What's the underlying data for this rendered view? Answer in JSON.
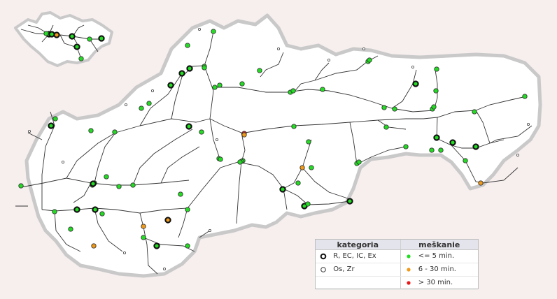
{
  "legend": {
    "header_category": "kategoria",
    "header_delay": "meškanie",
    "categories": [
      {
        "label": "R, EC, IC, Ex",
        "symbol": "thick-ring"
      },
      {
        "label": "Os, Zr",
        "symbol": "thin-ring"
      }
    ],
    "delays": [
      {
        "label": "<= 5 min.",
        "color": "#22dd22"
      },
      {
        "label": "6 - 30 min.",
        "color": "#f09a1a"
      },
      {
        "label": "> 30 min.",
        "color": "#e81818"
      }
    ]
  },
  "colors": {
    "country_fill": "#ffffff",
    "country_border": "#c9c9c9",
    "background": "#f7eeee",
    "track": "#333333",
    "on_time": "#22dd22",
    "delayed_minor": "#f09a1a",
    "delayed_major": "#e81818"
  },
  "trains": [
    {
      "category": "fast",
      "delay": "on_time"
    },
    {
      "category": "fast",
      "delay": "delayed_minor"
    },
    {
      "category": "fast",
      "delay": "on_time"
    },
    {
      "category": "fast",
      "delay": "on_time"
    },
    {
      "category": "fast",
      "delay": "on_time"
    },
    {
      "category": "fast",
      "delay": "on_time"
    },
    {
      "category": "regional",
      "delay": "on_time"
    },
    {
      "category": "regional",
      "delay": "on_time"
    },
    {
      "category": "regional",
      "delay": "on_time"
    },
    {
      "category": "fast",
      "delay": "on_time"
    },
    {
      "category": "fast",
      "delay": "on_time"
    },
    {
      "category": "fast",
      "delay": "on_time"
    },
    {
      "category": "regional",
      "delay": "on_time"
    },
    {
      "category": "regional",
      "delay": "on_time"
    },
    {
      "category": "regional",
      "delay": "on_time"
    },
    {
      "category": "regional",
      "delay": "on_time"
    },
    {
      "category": "regional",
      "delay": "on_time"
    },
    {
      "category": "regional",
      "delay": "on_time"
    },
    {
      "category": "fast",
      "delay": "on_time"
    },
    {
      "category": "regional",
      "delay": "on_time"
    },
    {
      "category": "regional",
      "delay": "on_time"
    },
    {
      "category": "fast",
      "delay": "on_time"
    },
    {
      "category": "regional",
      "delay": "on_time"
    },
    {
      "category": "regional",
      "delay": "on_time"
    },
    {
      "category": "regional",
      "delay": "on_time"
    },
    {
      "category": "regional",
      "delay": "on_time"
    },
    {
      "category": "regional",
      "delay": "on_time"
    },
    {
      "category": "regional",
      "delay": "on_time"
    },
    {
      "category": "regional",
      "delay": "on_time"
    },
    {
      "category": "regional",
      "delay": "on_time"
    },
    {
      "category": "regional",
      "delay": "on_time"
    },
    {
      "category": "regional",
      "delay": "on_time"
    },
    {
      "category": "regional",
      "delay": "on_time"
    },
    {
      "category": "regional",
      "delay": "on_time"
    },
    {
      "category": "fast",
      "delay": "on_time"
    },
    {
      "category": "regional",
      "delay": "on_time"
    },
    {
      "category": "regional",
      "delay": "on_time"
    },
    {
      "category": "regional",
      "delay": "on_time"
    },
    {
      "category": "regional",
      "delay": "on_time"
    },
    {
      "category": "regional",
      "delay": "on_time"
    },
    {
      "category": "regional",
      "delay": "on_time"
    },
    {
      "category": "regional",
      "delay": "on_time"
    },
    {
      "category": "fast",
      "delay": "on_time"
    },
    {
      "category": "fast",
      "delay": "on_time"
    },
    {
      "category": "regional",
      "delay": "on_time"
    },
    {
      "category": "regional",
      "delay": "on_time"
    },
    {
      "category": "regional",
      "delay": "delayed_major"
    },
    {
      "category": "regional",
      "delay": "on_time"
    },
    {
      "category": "regional",
      "delay": "on_time"
    },
    {
      "category": "regional",
      "delay": "on_time"
    },
    {
      "category": "regional",
      "delay": "delayed_minor"
    },
    {
      "category": "regional",
      "delay": "on_time"
    },
    {
      "category": "regional",
      "delay": "on_time"
    },
    {
      "category": "fast",
      "delay": "on_time"
    },
    {
      "category": "regional",
      "delay": "on_time"
    },
    {
      "category": "regional",
      "delay": "on_time"
    },
    {
      "category": "regional",
      "delay": "on_time"
    },
    {
      "category": "regional",
      "delay": "on_time"
    },
    {
      "category": "regional",
      "delay": "on_time"
    },
    {
      "category": "regional",
      "delay": "on_time"
    },
    {
      "category": "regional",
      "delay": "on_time"
    },
    {
      "category": "fast",
      "delay": "on_time"
    },
    {
      "category": "fast",
      "delay": "on_time"
    },
    {
      "category": "regional",
      "delay": "on_time"
    },
    {
      "category": "regional",
      "delay": "on_time"
    },
    {
      "category": "regional",
      "delay": "on_time"
    },
    {
      "category": "regional",
      "delay": "on_time"
    },
    {
      "category": "regional",
      "delay": "on_time"
    },
    {
      "category": "regional",
      "delay": "on_time"
    },
    {
      "category": "fast",
      "delay": "on_time"
    },
    {
      "category": "regional",
      "delay": "on_time"
    },
    {
      "category": "regional",
      "delay": "on_time"
    },
    {
      "category": "fast",
      "delay": "on_time"
    },
    {
      "category": "fast",
      "delay": "on_time"
    },
    {
      "category": "regional",
      "delay": "on_time"
    },
    {
      "category": "regional",
      "delay": "on_time"
    },
    {
      "category": "regional",
      "delay": "on_time"
    },
    {
      "category": "fast",
      "delay": "delayed_minor"
    },
    {
      "category": "regional",
      "delay": "delayed_minor"
    },
    {
      "category": "regional",
      "delay": "delayed_minor"
    },
    {
      "category": "regional",
      "delay": "on_time"
    },
    {
      "category": "regional",
      "delay": "on_time"
    },
    {
      "category": "fast",
      "delay": "on_time"
    },
    {
      "category": "regional",
      "delay": "on_time"
    },
    {
      "category": "regional",
      "delay": "delayed_minor"
    },
    {
      "category": "regional",
      "delay": "on_time"
    },
    {
      "category": "fast",
      "delay": "on_time"
    },
    {
      "category": "regional",
      "delay": "on_time"
    },
    {
      "category": "regional",
      "delay": "delayed_minor"
    }
  ]
}
